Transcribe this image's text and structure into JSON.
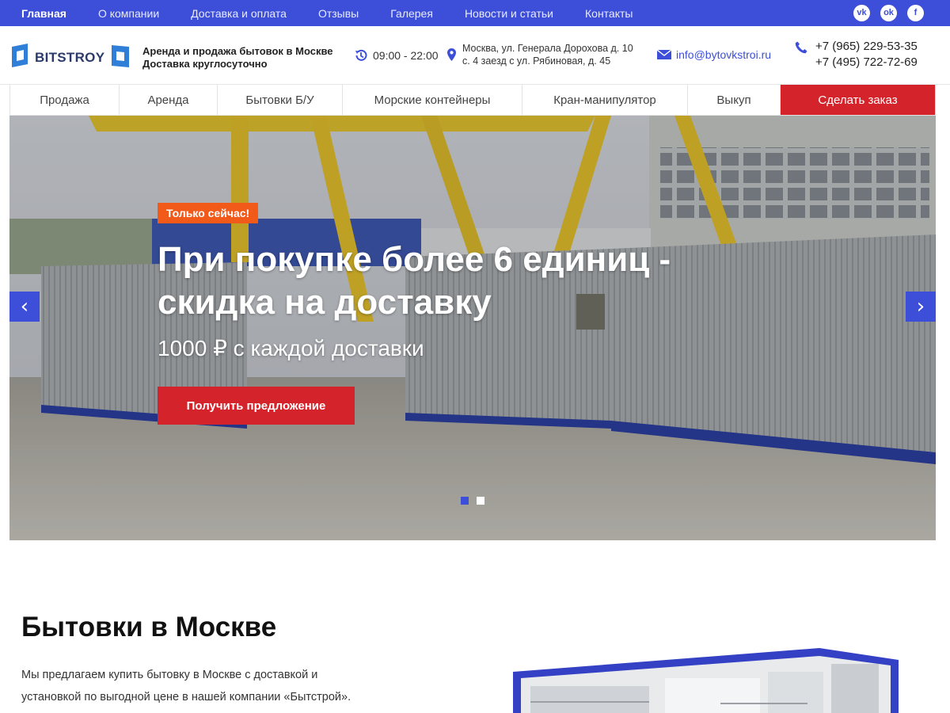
{
  "topnav": {
    "items": [
      "Главная",
      "О компании",
      "Доставка и оплата",
      "Отзывы",
      "Галерея",
      "Новости и статьи",
      "Контакты"
    ],
    "social": [
      "vk-icon",
      "odnoklassniki-icon",
      "facebook-icon"
    ],
    "social_glyphs": [
      "vk",
      "ok",
      "f"
    ]
  },
  "header": {
    "logo_text": "BITSTROY",
    "tagline_1": "Аренда и продажа бытовок в Москве",
    "tagline_2": "Доставка круглосуточно",
    "hours": "09:00 - 22:00",
    "address_1": "Москва, ул. Генерала Дорохова д. 10",
    "address_2": "с. 4 заезд с ул. Рябиновая, д. 45",
    "email": "info@bytovkstroi.ru",
    "phone_1": "+7 (965) 229-53-35",
    "phone_2": "+7 (495) 722-72-69"
  },
  "mainnav": {
    "items": [
      "Продажа",
      "Аренда",
      "Бытовки Б/У",
      "Морские контейнеры",
      "Кран-манипулятор",
      "Выкуп"
    ],
    "order_label": "Сделать заказ"
  },
  "hero": {
    "badge": "Только сейчас!",
    "title": "При покупке более 6 единиц - скидка на доставку",
    "subtitle": "1000 ₽ с каждой доставки",
    "cta": "Получить предложение",
    "prev": "‹",
    "next": "›",
    "slides_count": 2,
    "active_slide": 1
  },
  "content": {
    "title": "Бытовки в Москве",
    "text_1": "Мы предлагаем купить бытовку в Москве с доставкой и",
    "text_2": "установкой по выгодной цене в нашей компании «Бытстрой»."
  },
  "colors": {
    "brand_blue": "#3d4ed8",
    "accent_red": "#d5232b",
    "badge_orange": "#f25a1a"
  }
}
